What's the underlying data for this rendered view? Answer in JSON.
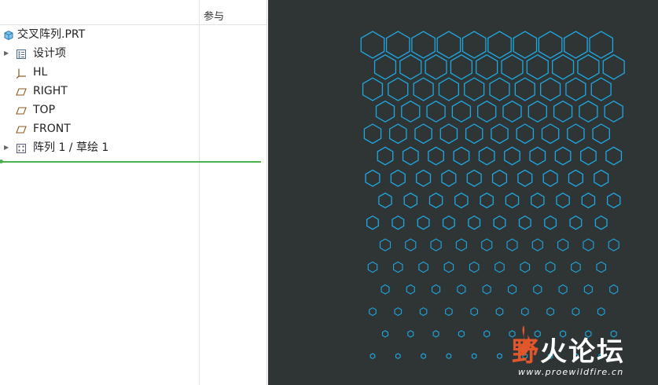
{
  "model_tree": {
    "column_header": "参与",
    "root": {
      "label": "交叉阵列.PRT",
      "icon": "part-icon"
    },
    "items": [
      {
        "label": "设计项",
        "icon": "design-items-icon",
        "expandable": true
      },
      {
        "label": "HL",
        "icon": "coordinate-system-icon",
        "expandable": false
      },
      {
        "label": "RIGHT",
        "icon": "datum-plane-icon",
        "expandable": false
      },
      {
        "label": "TOP",
        "icon": "datum-plane-icon",
        "expandable": false
      },
      {
        "label": "FRONT",
        "icon": "datum-plane-icon",
        "expandable": false
      },
      {
        "label": "阵列 1 / 草绘 1",
        "icon": "pattern-icon",
        "expandable": true
      }
    ]
  },
  "viewport": {
    "background": "#2f3435",
    "hex_color": "#1fa8e0",
    "watermark": {
      "main_first": "野",
      "main_rest": "火论坛",
      "url": "www.proewildfire.cn"
    }
  }
}
